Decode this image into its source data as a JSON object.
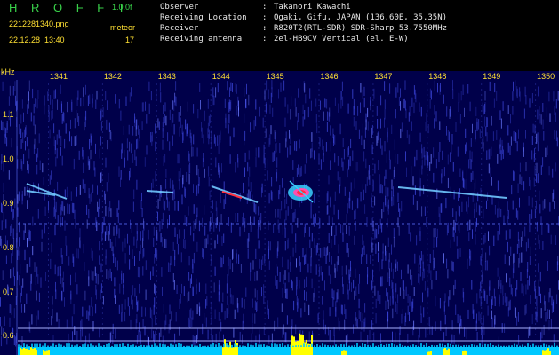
{
  "app": {
    "title": "H R O F F T",
    "version": "1.0.0f",
    "filename": "2212281340.png",
    "meteor_label": "meteor",
    "datetime": "22.12.28  13:40",
    "meteor_count": "17"
  },
  "info": [
    {
      "label": "Observer",
      "value": "Takanori Kawachi"
    },
    {
      "label": "Receiving Location",
      "value": "Ogaki, Gifu, JAPAN (136.60E, 35.35N)"
    },
    {
      "label": "Receiver",
      "value": "R820T2(RTL-SDR) SDR-Sharp 53.7550MHz"
    },
    {
      "label": "Receiving antenna",
      "value": "2el-HB9CV Vertical (el. E-W)"
    }
  ],
  "separator": ":",
  "axis": {
    "unit": "kHz",
    "y_ticks": [
      "1.1",
      "1.0",
      "0.9",
      "0.8",
      "0.7",
      "0.6"
    ],
    "x_ticks": [
      "1341",
      "1342",
      "1343",
      "1344",
      "1345",
      "1346",
      "1347",
      "1348",
      "1349",
      "1350"
    ]
  },
  "colors": {
    "background": "#00004a",
    "noise": "#3a44d8",
    "trace": "#70c8ff",
    "echo_core": "#ff3040",
    "amplitude_bar": "#ffff00",
    "baseline": "#00c8ff",
    "tick_text": "#ffe033",
    "header_green": "#39d24a"
  }
}
